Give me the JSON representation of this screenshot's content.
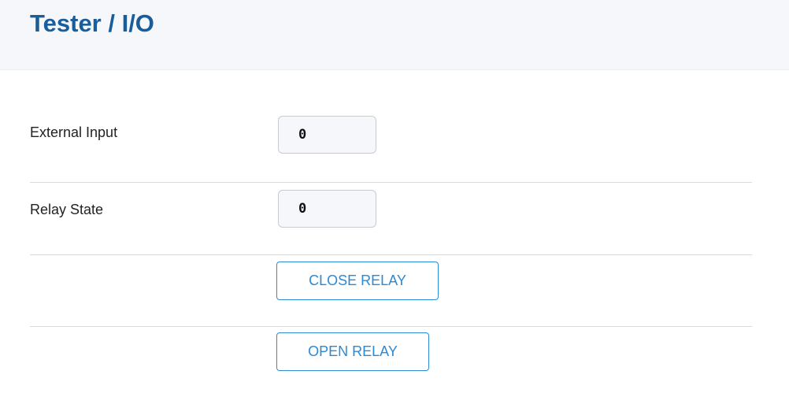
{
  "header": {
    "title": "Tester / I/O"
  },
  "rows": [
    {
      "label": "External Input",
      "value": "0"
    },
    {
      "label": "Relay State",
      "value": "0"
    }
  ],
  "actions": {
    "close_relay_label": "CLOSE RELAY",
    "open_relay_label": "OPEN RELAY"
  },
  "colors": {
    "title": "#1a5d9b",
    "button_accent": "#2b8ad6",
    "header_background": "#f5f7fa",
    "divider": "#d9dcdf"
  }
}
